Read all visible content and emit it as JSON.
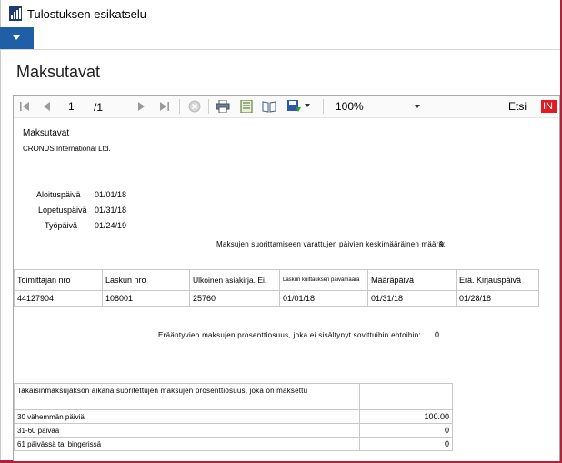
{
  "window": {
    "title": "Tulostuksen esikatselu"
  },
  "page": {
    "title": "Maksutavat"
  },
  "toolbar": {
    "current_page": "1",
    "total_pages": "/1",
    "zoom": "100%",
    "find_label": "Etsi",
    "next_label": "IN",
    "accent_color": "#1e5fa8",
    "next_color": "#e01b24"
  },
  "report": {
    "title": "Maksutavat",
    "company": "CRONUS International Ltd.",
    "start_date_label": "Aloituspäivä",
    "start_date": "01/01/18",
    "end_date_label": "Lopetuspäivä",
    "end_date": "01/31/18",
    "work_date_label": "Työpäivä",
    "work_date": "01/24/19",
    "avg_days_label": "Maksujen suorittamiseen varattujen päivien keskimääräinen määrä:",
    "avg_days_value": "9",
    "columns": [
      "Toimittajan nro",
      "Laskun nro",
      "Ulkoinen asiakirja. Ei.",
      "Laskun kuittauksen päivämäärä",
      "Määräpäivä",
      "Erä. Kirjauspäivä"
    ],
    "rows": [
      [
        "44127904",
        "108001",
        "25760",
        "01/01/18",
        "01/31/18",
        "01/28/18"
      ]
    ],
    "overdue_label": "Erääntyvien maksujen prosenttiosuus, joka ei sisältynyt sovittuihin ehtoihin:",
    "overdue_value": "0",
    "summary_header": "Takaisinmaksujakson aikana suoritettujen maksujen prosenttiosuus, joka on maksettu",
    "summary_rows": [
      {
        "label": "30 vähemmän päiviä",
        "value": "100.00"
      },
      {
        "label": "31-60 päivää",
        "value": "0"
      },
      {
        "label": "61 päivässä tai bingerissä",
        "value": "0"
      }
    ]
  }
}
